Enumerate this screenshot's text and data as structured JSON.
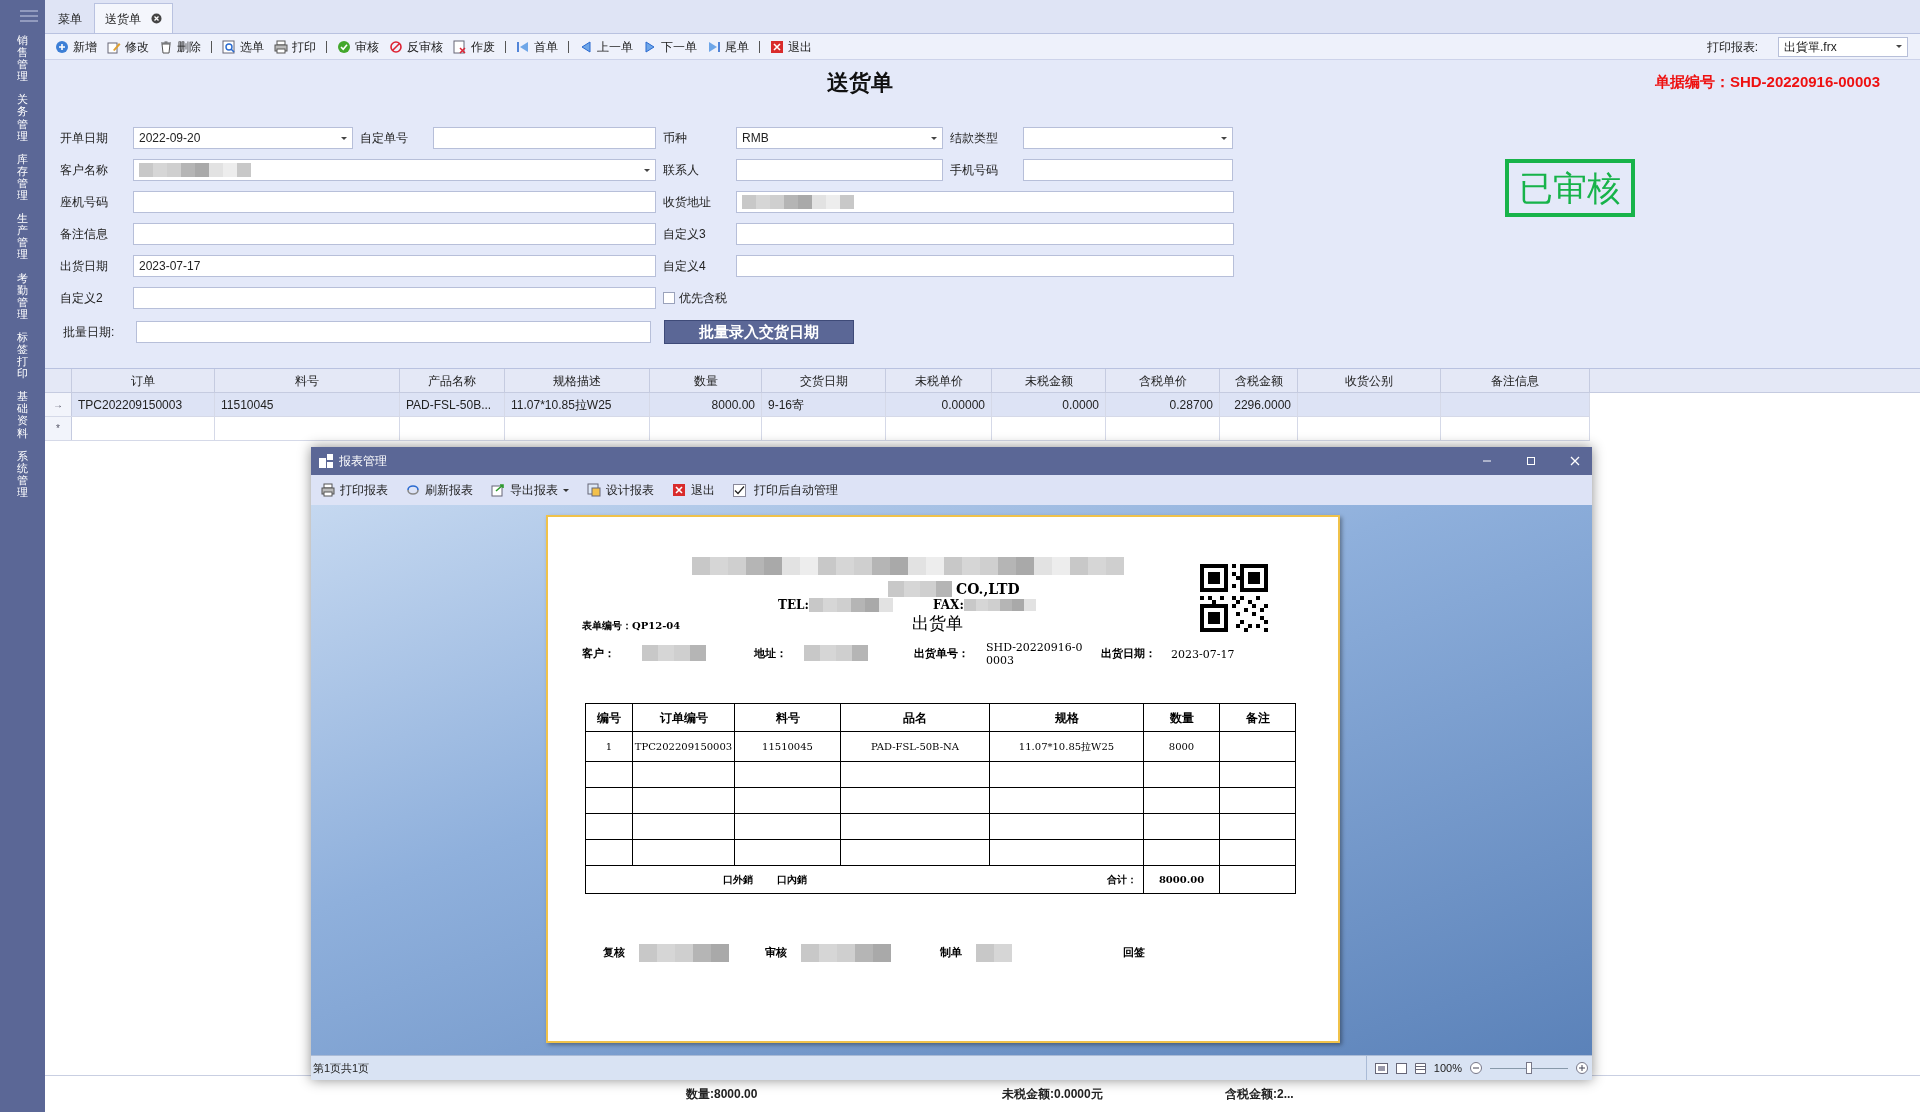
{
  "sidebar": {
    "items": [
      {
        "label": "销售管理"
      },
      {
        "label": "关务管理"
      },
      {
        "label": "库存管理"
      },
      {
        "label": "生产管理"
      },
      {
        "label": "考勤管理"
      },
      {
        "label": "标签打印"
      },
      {
        "label": "基础资料"
      },
      {
        "label": "系统管理"
      }
    ]
  },
  "tabs": [
    {
      "label": "菜单",
      "selected": false,
      "closable": false
    },
    {
      "label": "送货单",
      "selected": true,
      "closable": true
    }
  ],
  "toolbar": {
    "items": [
      {
        "kind": "button",
        "label": "新增"
      },
      {
        "kind": "button",
        "label": "修改"
      },
      {
        "kind": "button",
        "label": "删除"
      },
      {
        "kind": "separator"
      },
      {
        "kind": "button",
        "label": "选单"
      },
      {
        "kind": "button",
        "label": "打印"
      },
      {
        "kind": "separator"
      },
      {
        "kind": "button",
        "label": "审核"
      },
      {
        "kind": "button",
        "label": "反审核"
      },
      {
        "kind": "button",
        "label": "作废"
      },
      {
        "kind": "separator"
      },
      {
        "kind": "button",
        "label": "首单"
      },
      {
        "kind": "separator"
      },
      {
        "kind": "button",
        "label": "上一单"
      },
      {
        "kind": "button",
        "label": "下一单"
      },
      {
        "kind": "button",
        "label": "尾单"
      },
      {
        "kind": "separator"
      },
      {
        "kind": "button",
        "label": "退出"
      }
    ],
    "print_report": {
      "label": "打印报表:",
      "value": "出貨單.frx"
    }
  },
  "document": {
    "title": "送货单",
    "number_label": "单据编号：",
    "number": "SHD-20220916-00003",
    "stamp": "已审核"
  },
  "form": {
    "fields": [
      {
        "kind": "dropdown",
        "label": "开单日期",
        "value": "2022-09-20"
      },
      {
        "kind": "text",
        "label": "自定单号"
      },
      {
        "kind": "dropdown",
        "label": "币种",
        "value": "RMB"
      },
      {
        "kind": "dropdown",
        "label": "结款类型"
      },
      {
        "kind": "dropdown",
        "label": "客户名称",
        "redacted": true
      },
      {
        "kind": "text",
        "label": "联系人"
      },
      {
        "kind": "text",
        "label": "手机号码"
      },
      {
        "kind": "text",
        "label": "座机号码"
      },
      {
        "kind": "text",
        "label": "收货地址",
        "redacted": true
      },
      {
        "kind": "text",
        "label": "备注信息"
      },
      {
        "kind": "text",
        "label": "自定义3"
      },
      {
        "kind": "text",
        "label": "出货日期",
        "value": "2023-07-17"
      },
      {
        "kind": "text",
        "label": "自定义4"
      },
      {
        "kind": "text",
        "label": "自定义2"
      },
      {
        "kind": "checkbox",
        "label": "优先含税",
        "checked": false
      }
    ],
    "batch": {
      "label": "批量日期:",
      "button": "批量录入交货日期"
    }
  },
  "grid": {
    "columns": [
      "订单",
      "料号",
      "产品名称",
      "规格描述",
      "数量",
      "交货日期",
      "未税单价",
      "未税金额",
      "含税单价",
      "含税金额",
      "收货公别",
      "备注信息"
    ],
    "rows": [
      {
        "selected": true,
        "marker": "→",
        "cells": [
          "TPC202209150003",
          "11510045",
          "PAD-FSL-50B...",
          "11.07*10.85拉W25",
          "8000.00",
          "9-16寄",
          "0.00000",
          "0.0000",
          "0.28700",
          "2296.0000"
        ]
      },
      {
        "selected": false,
        "marker": "*"
      }
    ]
  },
  "report_dialog": {
    "title": "报表管理",
    "toolbar": [
      {
        "kind": "button",
        "label": "打印报表"
      },
      {
        "kind": "button",
        "label": "刷新报表"
      },
      {
        "kind": "menu",
        "label": "导出报表"
      },
      {
        "kind": "button",
        "label": "设计报表"
      },
      {
        "kind": "button",
        "label": "退出"
      },
      {
        "kind": "checkbox",
        "label": "打印后自动管理",
        "checked": true
      }
    ],
    "paper": {
      "company_suffix": "CO.,LTD",
      "tel_label": "TEL:",
      "fax_label": "FAX:",
      "form_no": "表单编号：QP12-04",
      "title": "出货单",
      "info": [
        {
          "label": "客户：",
          "redacted": true
        },
        {
          "label": "地址：",
          "redacted": true
        },
        {
          "label": "出货单号：",
          "value": "SHD-20220916-00003"
        },
        {
          "label": "出货日期：",
          "value": "2023-07-17"
        }
      ],
      "columns": [
        "编号",
        "订单编号",
        "料号",
        "品名",
        "规格",
        "数量",
        "备注"
      ],
      "rows": [
        [
          "1",
          "TPC202209150003",
          "11510045",
          "PAD-FSL-50B-NA",
          "11.07*10.85拉W25",
          "8000"
        ]
      ],
      "export_marks": [
        "口外銷",
        "口內銷"
      ],
      "total_label": "合计：",
      "total": "8000.00",
      "signatures": [
        {
          "label": "复核",
          "redacted": true
        },
        {
          "label": "审核",
          "redacted": true
        },
        {
          "label": "制单",
          "redacted": true
        },
        {
          "label": "回签",
          "redacted": false
        }
      ]
    },
    "status": {
      "page": "第1页共1页",
      "zoom": "100%",
      "level": 0.5
    }
  },
  "summary": [
    "数量:8000.00",
    "未税金额:0.0000元",
    "含税金额:2..."
  ]
}
